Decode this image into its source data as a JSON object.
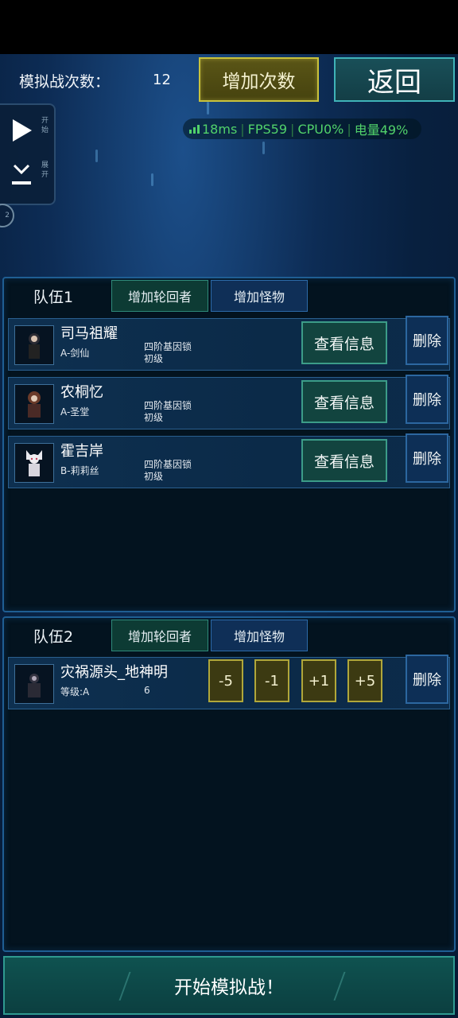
{
  "header": {
    "sim_label": "模拟战次数：",
    "sim_count": "12",
    "add_count_label": "增加次数",
    "back_label": "返回"
  },
  "perf": {
    "ping": "18ms",
    "fps": "FPS59",
    "cpu": "CPU0%",
    "battery": "电量49%"
  },
  "float_panel": {
    "start_label": "开始",
    "expand_label": "展开",
    "badge": "2"
  },
  "team1": {
    "title": "队伍1",
    "tab_add_player": "增加轮回者",
    "tab_add_monster": "增加怪物",
    "members": [
      {
        "name": "司马祖耀",
        "sub": "A-剑仙",
        "gene": "四阶基因锁",
        "grade": "初级",
        "info_label": "查看信息",
        "delete_label": "删除"
      },
      {
        "name": "农桐忆",
        "sub": "A-圣堂",
        "gene": "四阶基因锁",
        "grade": "初级",
        "info_label": "查看信息",
        "delete_label": "删除"
      },
      {
        "name": "霍吉岸",
        "sub": "B-莉莉丝",
        "gene": "四阶基因锁",
        "grade": "初级",
        "info_label": "查看信息",
        "delete_label": "删除"
      }
    ]
  },
  "team2": {
    "title": "队伍2",
    "tab_add_player": "增加轮回者",
    "tab_add_monster": "增加怪物",
    "monster": {
      "name": "灾祸源头_地神明",
      "level_label": "等级:A",
      "level_value": "6",
      "minus5": "-5",
      "minus1": "-1",
      "plus1": "+1",
      "plus5": "+5",
      "delete_label": "删除"
    }
  },
  "start_battle_label": "开始模拟战！",
  "colors": {
    "accent_teal": "#3c9c88",
    "accent_gold": "#c9c23c",
    "panel_border": "#1f5e93",
    "perf_green": "#51d26a"
  }
}
